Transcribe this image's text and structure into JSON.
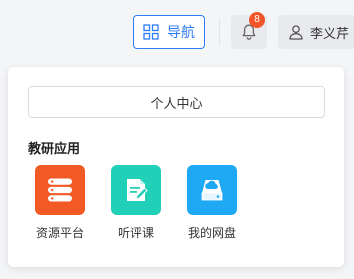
{
  "header": {
    "nav_button_label": "导航",
    "notification_count": "8",
    "user_name": "李义芹"
  },
  "panel": {
    "personal_center_label": "个人中心",
    "section_title": "教研应用",
    "apps": [
      {
        "label": "资源平台",
        "icon": "database-icon",
        "color": "#f15a24"
      },
      {
        "label": "听评课",
        "icon": "edit-document-icon",
        "color": "#22cfb7"
      },
      {
        "label": "我的网盘",
        "icon": "cloud-drive-icon",
        "color": "#1fa9f4"
      }
    ]
  },
  "colors": {
    "accent": "#2d7cf5",
    "badge": "#f0562a"
  }
}
